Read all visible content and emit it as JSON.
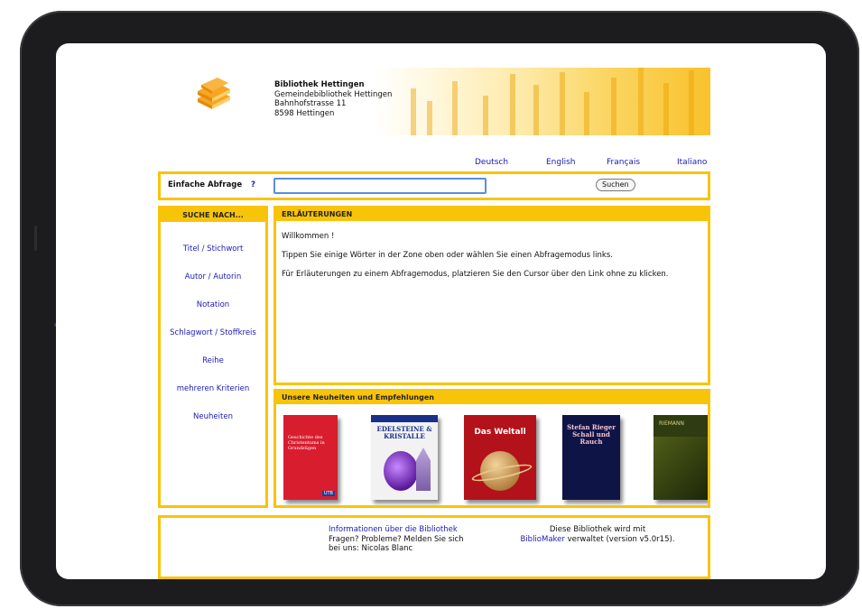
{
  "library": {
    "name": "Bibliothek Hettingen",
    "subtitle": "Gemeindebibliothek Hettingen",
    "street": "Bahnhofstrasse 11",
    "city": "8598 Hettingen"
  },
  "languages": [
    "Deutsch",
    "English",
    "Français",
    "Italiano"
  ],
  "search": {
    "label": "Einfache Abfrage",
    "help": "?",
    "value": "",
    "button": "Suchen"
  },
  "sidebar": {
    "header": "SUCHE NACH...",
    "items": [
      "Titel / Stichwort",
      "Autor / Autorin",
      "Notation",
      "Schlagwort / Stoffkreis",
      "Reihe",
      "mehreren Kriterien",
      "Neuheiten"
    ]
  },
  "explanations": {
    "header": "ERLÄUTERUNGEN",
    "lines": [
      "Willkommen !",
      "Tippen Sie einige Wörter in der Zone oben oder wählen Sie einen Abfragemodus links.",
      "Für Erläuterungen zu einem Abfragemodus, platzieren Sie den Cursor über den Link ohne zu klicken."
    ]
  },
  "news": {
    "header": "Unsere Neuheiten und Empfehlungen",
    "books": [
      {
        "title": "Geschichte des Christentums in Grundzügen",
        "publisher": "UTB",
        "color": "#d81d2f"
      },
      {
        "title": "EDELSTEINE & KRISTALLE",
        "color": "#f2f2f2"
      },
      {
        "title": "Das Weltall",
        "color": "#b3121a"
      },
      {
        "title": "Stefan Rieger Schall und Rauch",
        "color": "#0f1446"
      },
      {
        "title": "RIEMANN",
        "color": "#2f3b10"
      }
    ]
  },
  "footer": {
    "info_link": "Informationen über die Bibliothek",
    "info_text": "Fragen? Probleme? Melden Sie sich bei uns: Nicolas Blanc",
    "bm_text1": "Diese Bibliothek wird mit",
    "bm_link": "BiblioMaker",
    "bm_text2": "verwaltet (version v5.0r15)."
  }
}
